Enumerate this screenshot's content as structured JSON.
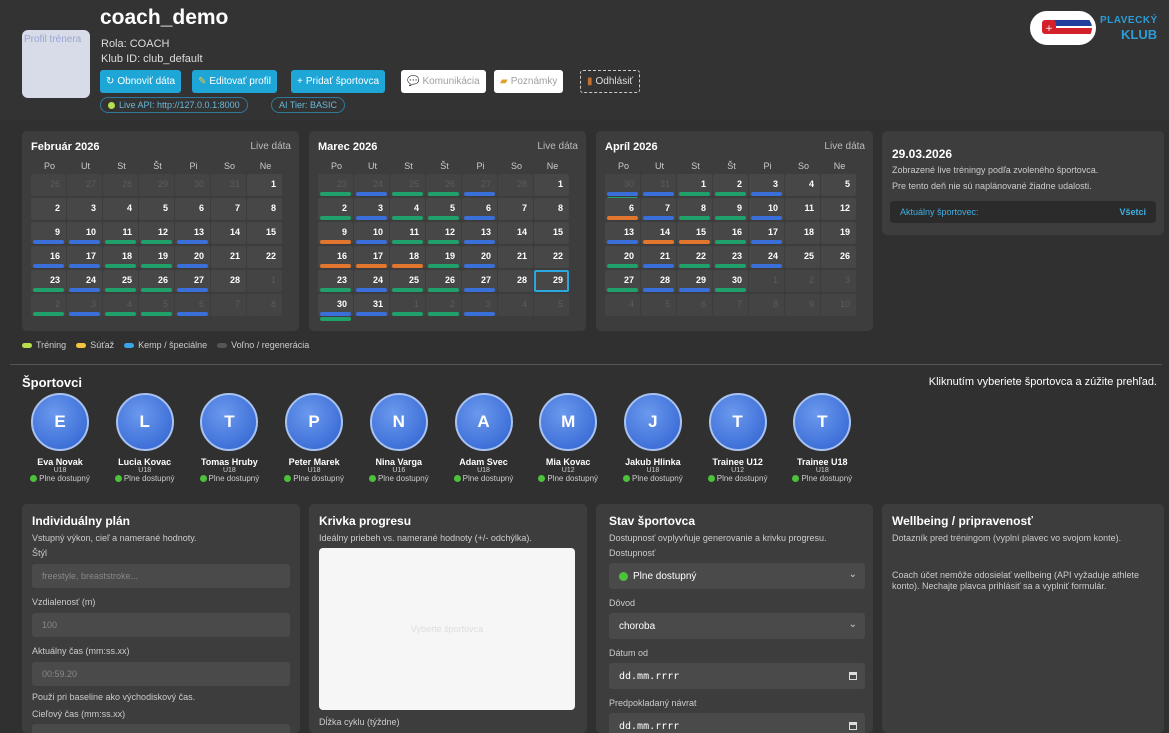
{
  "header": {
    "coach_name": "coach_demo",
    "role": "Rola: COACH",
    "club_id": "Klub ID: club_default",
    "avatar_alt": "Profil trénera",
    "buttons": {
      "refresh": "Obnoviť dáta",
      "edit_profile": "Editovať profil",
      "add_athlete": "Pridať športovca",
      "communication": "Komunikácia",
      "notes": "Poznámky",
      "logout": "Odhlásiť"
    },
    "live_api": "Live API: http://127.0.0.1:8000",
    "ai_tier": "AI Tier: BASIC",
    "logo": {
      "line1": "PLAVECKÝ",
      "line2": "KLUB"
    }
  },
  "weekdays": [
    "Po",
    "Ut",
    "St",
    "Št",
    "Pi",
    "So",
    "Ne"
  ],
  "live_label": "Live dáta",
  "calendars": [
    {
      "title": "Február 2026",
      "cells": [
        {
          "d": "26",
          "o": true
        },
        {
          "d": "27",
          "o": true
        },
        {
          "d": "28",
          "o": true
        },
        {
          "d": "29",
          "o": true
        },
        {
          "d": "30",
          "o": true
        },
        {
          "d": "31",
          "o": true
        },
        {
          "d": "1"
        },
        {
          "d": "2"
        },
        {
          "d": "3"
        },
        {
          "d": "4"
        },
        {
          "d": "5"
        },
        {
          "d": "6"
        },
        {
          "d": "7"
        },
        {
          "d": "8"
        },
        {
          "d": "9",
          "b": [
            "blue"
          ]
        },
        {
          "d": "10",
          "b": [
            "blue"
          ]
        },
        {
          "d": "11",
          "b": [
            "green"
          ]
        },
        {
          "d": "12",
          "b": [
            "green"
          ]
        },
        {
          "d": "13",
          "b": [
            "blue"
          ]
        },
        {
          "d": "14"
        },
        {
          "d": "15"
        },
        {
          "d": "16",
          "b": [
            "blue"
          ]
        },
        {
          "d": "17",
          "b": [
            "blue"
          ]
        },
        {
          "d": "18",
          "b": [
            "green"
          ]
        },
        {
          "d": "19",
          "b": [
            "green"
          ]
        },
        {
          "d": "20",
          "b": [
            "blue"
          ]
        },
        {
          "d": "21"
        },
        {
          "d": "22"
        },
        {
          "d": "23",
          "b": [
            "green"
          ]
        },
        {
          "d": "24",
          "b": [
            "blue"
          ]
        },
        {
          "d": "25",
          "b": [
            "green"
          ]
        },
        {
          "d": "26",
          "b": [
            "green"
          ]
        },
        {
          "d": "27",
          "b": [
            "blue"
          ]
        },
        {
          "d": "28"
        },
        {
          "d": "1",
          "o": true
        },
        {
          "d": "2",
          "o": true,
          "b": [
            "green"
          ]
        },
        {
          "d": "3",
          "o": true,
          "b": [
            "blue"
          ]
        },
        {
          "d": "4",
          "o": true,
          "b": [
            "green"
          ]
        },
        {
          "d": "5",
          "o": true,
          "b": [
            "green"
          ]
        },
        {
          "d": "6",
          "o": true,
          "b": [
            "blue"
          ]
        },
        {
          "d": "7",
          "o": true
        },
        {
          "d": "8",
          "o": true
        }
      ]
    },
    {
      "title": "Marec 2026",
      "cells": [
        {
          "d": "23",
          "o": true,
          "b": [
            "green"
          ]
        },
        {
          "d": "24",
          "o": true,
          "b": [
            "blue"
          ]
        },
        {
          "d": "25",
          "o": true,
          "b": [
            "green"
          ]
        },
        {
          "d": "26",
          "o": true,
          "b": [
            "green"
          ]
        },
        {
          "d": "27",
          "o": true,
          "b": [
            "blue"
          ]
        },
        {
          "d": "28",
          "o": true
        },
        {
          "d": "1"
        },
        {
          "d": "2",
          "b": [
            "green"
          ]
        },
        {
          "d": "3",
          "b": [
            "blue"
          ]
        },
        {
          "d": "4",
          "b": [
            "green"
          ]
        },
        {
          "d": "5",
          "b": [
            "green"
          ]
        },
        {
          "d": "6",
          "b": [
            "blue"
          ]
        },
        {
          "d": "7"
        },
        {
          "d": "8"
        },
        {
          "d": "9",
          "b": [
            "orange"
          ]
        },
        {
          "d": "10",
          "b": [
            "blue"
          ]
        },
        {
          "d": "11",
          "b": [
            "green"
          ]
        },
        {
          "d": "12",
          "b": [
            "green"
          ]
        },
        {
          "d": "13",
          "b": [
            "blue"
          ]
        },
        {
          "d": "14"
        },
        {
          "d": "15"
        },
        {
          "d": "16",
          "b": [
            "orange"
          ]
        },
        {
          "d": "17",
          "b": [
            "orange"
          ]
        },
        {
          "d": "18",
          "b": [
            "orange"
          ]
        },
        {
          "d": "19",
          "b": [
            "green"
          ]
        },
        {
          "d": "20",
          "b": [
            "blue"
          ]
        },
        {
          "d": "21"
        },
        {
          "d": "22"
        },
        {
          "d": "23",
          "b": [
            "green"
          ]
        },
        {
          "d": "24",
          "b": [
            "blue"
          ]
        },
        {
          "d": "25",
          "b": [
            "green"
          ]
        },
        {
          "d": "26",
          "b": [
            "green"
          ]
        },
        {
          "d": "27",
          "b": [
            "blue"
          ]
        },
        {
          "d": "28"
        },
        {
          "d": "29",
          "t": true
        },
        {
          "d": "30",
          "b": [
            "blue",
            "green"
          ]
        },
        {
          "d": "31",
          "b": [
            "blue"
          ]
        },
        {
          "d": "1",
          "o": true,
          "b": [
            "green"
          ]
        },
        {
          "d": "2",
          "o": true,
          "b": [
            "green"
          ]
        },
        {
          "d": "3",
          "o": true,
          "b": [
            "blue"
          ]
        },
        {
          "d": "4",
          "o": true
        },
        {
          "d": "5",
          "o": true
        }
      ]
    },
    {
      "title": "Apríl 2026",
      "cells": [
        {
          "d": "30",
          "o": true,
          "b": [
            "blue",
            "green"
          ]
        },
        {
          "d": "31",
          "o": true,
          "b": [
            "blue"
          ]
        },
        {
          "d": "1",
          "b": [
            "green"
          ]
        },
        {
          "d": "2",
          "b": [
            "green"
          ]
        },
        {
          "d": "3",
          "b": [
            "blue"
          ]
        },
        {
          "d": "4"
        },
        {
          "d": "5"
        },
        {
          "d": "6",
          "b": [
            "orange"
          ]
        },
        {
          "d": "7",
          "b": [
            "blue"
          ]
        },
        {
          "d": "8",
          "b": [
            "green"
          ]
        },
        {
          "d": "9",
          "b": [
            "green"
          ]
        },
        {
          "d": "10",
          "b": [
            "blue"
          ]
        },
        {
          "d": "11"
        },
        {
          "d": "12"
        },
        {
          "d": "13",
          "b": [
            "blue"
          ]
        },
        {
          "d": "14",
          "b": [
            "orange"
          ]
        },
        {
          "d": "15",
          "b": [
            "orange"
          ]
        },
        {
          "d": "16",
          "b": [
            "green"
          ]
        },
        {
          "d": "17",
          "b": [
            "blue"
          ]
        },
        {
          "d": "18"
        },
        {
          "d": "19"
        },
        {
          "d": "20",
          "b": [
            "green"
          ]
        },
        {
          "d": "21",
          "b": [
            "blue"
          ]
        },
        {
          "d": "22",
          "b": [
            "green"
          ]
        },
        {
          "d": "23",
          "b": [
            "green"
          ]
        },
        {
          "d": "24",
          "b": [
            "blue"
          ]
        },
        {
          "d": "25"
        },
        {
          "d": "26"
        },
        {
          "d": "27",
          "b": [
            "green"
          ]
        },
        {
          "d": "28",
          "b": [
            "blue"
          ]
        },
        {
          "d": "29",
          "b": [
            "blue"
          ]
        },
        {
          "d": "30",
          "b": [
            "green"
          ]
        },
        {
          "d": "1",
          "o": true
        },
        {
          "d": "2",
          "o": true
        },
        {
          "d": "3",
          "o": true
        },
        {
          "d": "4",
          "o": true
        },
        {
          "d": "5",
          "o": true
        },
        {
          "d": "6",
          "o": true
        },
        {
          "d": "7",
          "o": true
        },
        {
          "d": "8",
          "o": true
        },
        {
          "d": "9",
          "o": true
        },
        {
          "d": "10",
          "o": true
        }
      ]
    }
  ],
  "event_panel": {
    "date": "29.03.2026",
    "desc": "Zobrazené live tréningy podľa zvoleného športovca.",
    "none": "Pre tento deň nie sú naplánované žiadne udalosti.",
    "athlete_label": "Aktuálny športovec:",
    "athlete_value": "Všetci"
  },
  "legend": [
    {
      "label": "Tréning",
      "color": "#b7e04f"
    },
    {
      "label": "Súťaž",
      "color": "#f3c53c"
    },
    {
      "label": "Kemp / špeciálne",
      "color": "#3aa4e8"
    },
    {
      "label": "Voľno / regenerácia",
      "color": "#555555"
    }
  ],
  "athletes_section": {
    "title": "Športovci",
    "hint": "Kliknutím vyberiete športovca a zúžite prehľad.",
    "list": [
      {
        "initial": "E",
        "name": "Eva Novak",
        "age": "U18",
        "status": "Plne dostupný"
      },
      {
        "initial": "L",
        "name": "Lucia Kovac",
        "age": "U18",
        "status": "Plne dostupný"
      },
      {
        "initial": "T",
        "name": "Tomas Hruby",
        "age": "U18",
        "status": "Plne dostupný"
      },
      {
        "initial": "P",
        "name": "Peter Marek",
        "age": "U18",
        "status": "Plne dostupný"
      },
      {
        "initial": "N",
        "name": "Nina Varga",
        "age": "U16",
        "status": "Plne dostupný"
      },
      {
        "initial": "A",
        "name": "Adam Svec",
        "age": "U18",
        "status": "Plne dostupný"
      },
      {
        "initial": "M",
        "name": "Mia Kovac",
        "age": "U12",
        "status": "Plne dostupný"
      },
      {
        "initial": "J",
        "name": "Jakub Hlinka",
        "age": "U18",
        "status": "Plne dostupný"
      },
      {
        "initial": "T",
        "name": "Trainee U12",
        "age": "U12",
        "status": "Plne dostupný"
      },
      {
        "initial": "T",
        "name": "Trainee U18",
        "age": "U18",
        "status": "Plne dostupný"
      }
    ]
  },
  "plan": {
    "title": "Individuálny plán",
    "sub": "Vstupný výkon, cieľ a namerané hodnoty.",
    "style_label": "Štýl",
    "style_placeholder": "freestyle, breaststroke...",
    "distance_label": "Vzdialenosť (m)",
    "distance_placeholder": "100",
    "time_label": "Aktuálny čas (mm:ss.xx)",
    "time_placeholder": "00:59.20",
    "time_hint": "Použi pri baseline ako východiskový čas.",
    "target_label": "Cieľový čas (mm:ss.xx)"
  },
  "progress": {
    "title": "Krivka progresu",
    "sub": "Ideálny priebeh vs. namerané hodnoty (+/- odchýlka).",
    "empty": "Vyberte športovca",
    "cycle_label": "Dĺžka cyklu (týždne)"
  },
  "status": {
    "title": "Stav športovca",
    "sub": "Dostupnosť ovplyvňuje generovanie a krivku progresu.",
    "availability_label": "Dostupnosť",
    "availability_value": "Plne dostupný",
    "reason_label": "Dôvod",
    "reason_value": "choroba",
    "date_from_label": "Dátum od",
    "date_from_value": "dd.mm.rrrr",
    "return_label": "Predpokladaný návrat",
    "return_value": "dd.mm.rrrr"
  },
  "wellbeing": {
    "title": "Wellbeing / pripravenosť",
    "sub": "Dotazník pred tréningom (vyplní plavec vo svojom konte).",
    "note": "Coach účet nemôže odosielať wellbeing (API vyžaduje athlete konto). Nechajte plavca prihlásiť sa a vyplniť formulár."
  }
}
